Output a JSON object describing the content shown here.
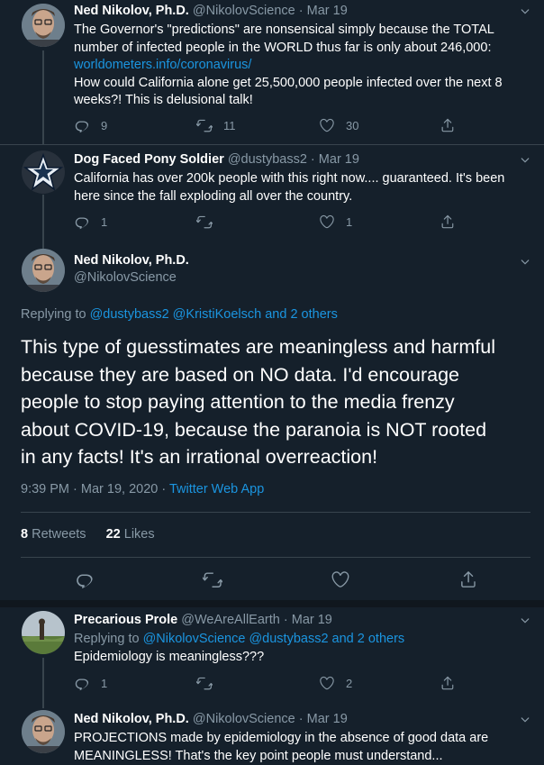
{
  "tweets": [
    {
      "name": "Ned Nikolov, Ph.D.",
      "handle": "@NikolovScience",
      "sep": "·",
      "date": "Mar 19",
      "line1": "The Governor's \"predictions\" are nonsensical simply because the TOTAL",
      "line2": "number of infected people in the WORLD thus far is only about 246,000:",
      "link": "worldometers.info/coronavirus/",
      "line3": "How could California alone get 25,500,000 people infected over the next 8",
      "line4": "weeks?! This is delusional talk!",
      "replies": "9",
      "retweets": "11",
      "likes": "30"
    },
    {
      "name": "Dog Faced Pony Soldier",
      "handle": "@dustybass2",
      "sep": "·",
      "date": "Mar 19",
      "line1": "California has over 200k people with this right now.... guaranteed.  It's been",
      "line2": "here since the fall exploding all over the country.",
      "replies": "1",
      "retweets": "",
      "likes": "1"
    }
  ],
  "main": {
    "name": "Ned Nikolov, Ph.D.",
    "handle": "@NikolovScience",
    "replying_prefix": "Replying to ",
    "replying_targets": "@dustybass2 @KristiKoelsch and 2 others",
    "text_lines": [
      "This type of guesstimates are meaningless and harmful",
      "because they are based on NO data. I'd encourage",
      "people to stop paying attention to the media frenzy",
      "about COVID-19, because the paranoia is NOT rooted",
      "in any facts! It's an irrational overreaction!"
    ],
    "timestamp": "9:39 PM · Mar 19, 2020 · ",
    "source": "Twitter Web App",
    "retweet_count": "8",
    "retweet_label": "Retweets",
    "like_count": "22",
    "like_label": "Likes"
  },
  "replies": [
    {
      "name": "Precarious Prole",
      "handle": "@WeAreAllEarth",
      "sep": "·",
      "date": "Mar 19",
      "replying_prefix": "Replying to ",
      "replying_targets": "@NikolovScience @dustybass2 and 2 others",
      "line1": "Epidemiology is meaningless???",
      "replies": "1",
      "retweets": "",
      "likes": "2"
    },
    {
      "name": "Ned Nikolov, Ph.D.",
      "handle": "@NikolovScience",
      "sep": "·",
      "date": "Mar 19",
      "line1": "PROJECTIONS made by epidemiology in the absence of good data are",
      "line2": "MEANINGLESS! That's the key point people must understand..."
    }
  ],
  "icons": {
    "reply": "reply-icon",
    "retweet": "retweet-icon",
    "like": "heart-icon",
    "share": "share-icon",
    "more": "chevron-down-icon"
  },
  "colors": {
    "background": "#15202b",
    "link": "#1b95e0",
    "muted": "#8899a6",
    "divider": "#38444d"
  }
}
